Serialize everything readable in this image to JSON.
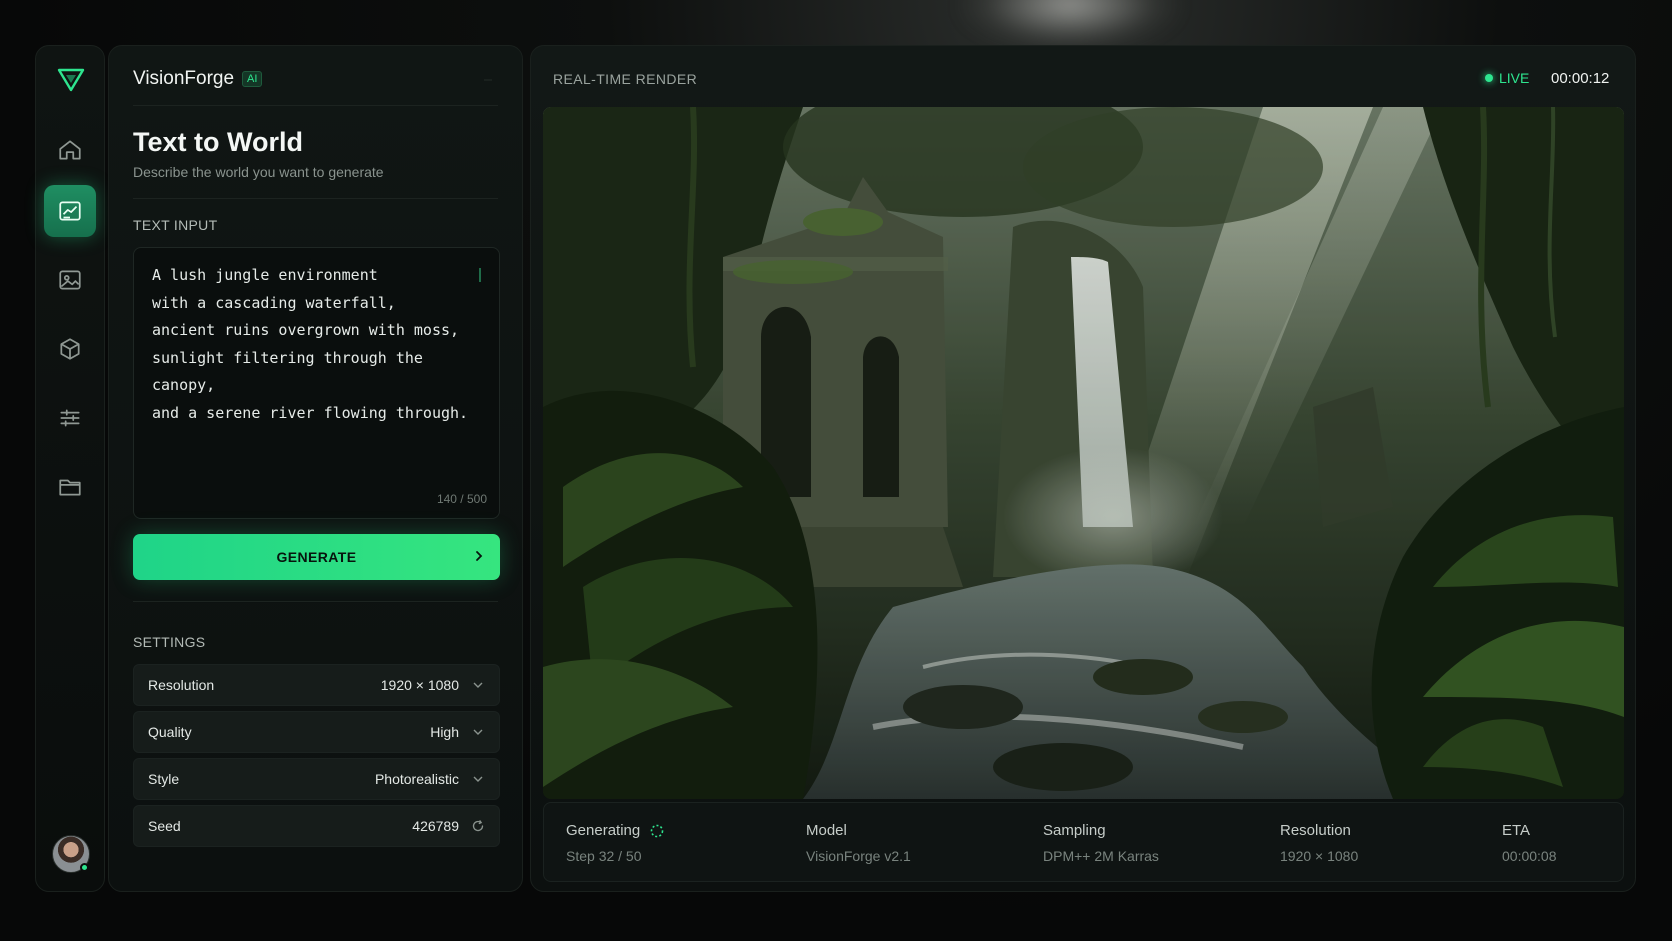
{
  "app": {
    "name": "VisionForge",
    "badge": "AI"
  },
  "page": {
    "title": "Text to World",
    "subtitle": "Describe the world you want to generate"
  },
  "text_input": {
    "label": "TEXT INPUT",
    "value": "A lush jungle environment\nwith a cascading waterfall,\nancient ruins overgrown with moss,\nsunlight filtering through the canopy,\nand a serene river flowing through.",
    "counter": "140 / 500"
  },
  "generate": {
    "label": "GENERATE"
  },
  "settings": {
    "label": "SETTINGS",
    "items": [
      {
        "label": "Resolution",
        "value": "1920 × 1080",
        "icon": "chevron-down-icon"
      },
      {
        "label": "Quality",
        "value": "High",
        "icon": "chevron-down-icon"
      },
      {
        "label": "Style",
        "value": "Photorealistic",
        "icon": "chevron-down-icon"
      },
      {
        "label": "Seed",
        "value": "426789",
        "icon": "refresh-icon"
      }
    ]
  },
  "render": {
    "title": "REAL-TIME RENDER",
    "live_label": "LIVE",
    "timer": "00:00:12"
  },
  "status": {
    "generating": {
      "label": "Generating",
      "value": "Step 32 / 50"
    },
    "model": {
      "label": "Model",
      "value": "VisionForge v2.1"
    },
    "sampling": {
      "label": "Sampling",
      "value": "DPM++ 2M Karras"
    },
    "resolution": {
      "label": "Resolution",
      "value": "1920 × 1080"
    },
    "eta": {
      "label": "ETA",
      "value": "00:00:08"
    }
  },
  "nav": [
    "home-icon",
    "text-to-world-icon",
    "image-icon",
    "cube-icon",
    "sliders-icon",
    "folder-icon"
  ],
  "colors": {
    "accent": "#2ee58f",
    "button_start": "#1fd488",
    "button_end": "#36e57f"
  }
}
